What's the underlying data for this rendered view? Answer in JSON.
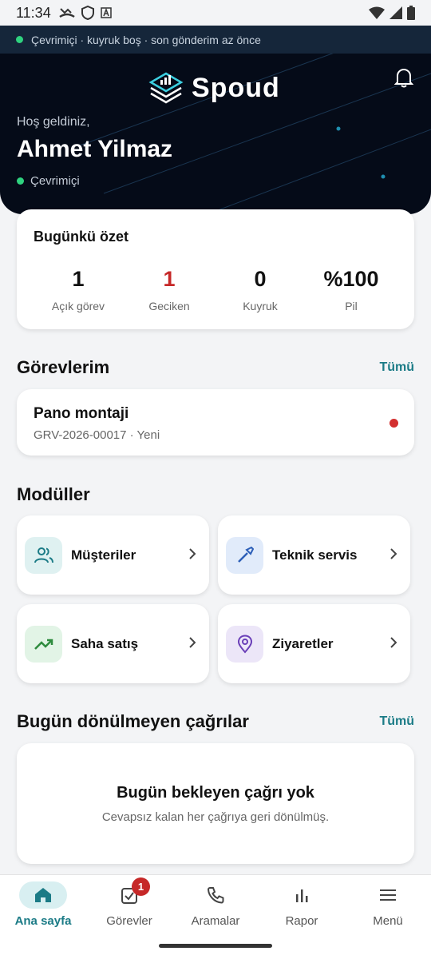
{
  "status_bar": {
    "time": "11:34"
  },
  "connection": {
    "text": "Çevrimiçi · kuyruk boş · son gönderim az önce"
  },
  "header": {
    "brand": "Spoud",
    "welcome": "Hoş geldiniz,",
    "user_name": "Ahmet Yilmaz",
    "user_status": "Çevrimiçi"
  },
  "summary": {
    "title": "Bugünkü özet",
    "stats": [
      {
        "value": "1",
        "label": "Açık görev"
      },
      {
        "value": "1",
        "label": "Geciken"
      },
      {
        "value": "0",
        "label": "Kuyruk"
      },
      {
        "value": "%100",
        "label": "Pil"
      }
    ]
  },
  "tasks": {
    "title": "Görevlerim",
    "see_all": "Tümü",
    "items": [
      {
        "title": "Pano montaji",
        "subtitle": "GRV-2026-00017 · Yeni"
      }
    ]
  },
  "modules": {
    "title": "Modüller",
    "items": [
      {
        "label": "Müşteriler",
        "icon": "users-icon"
      },
      {
        "label": "Teknik servis",
        "icon": "wrench-icon"
      },
      {
        "label": "Saha satış",
        "icon": "trend-up-icon"
      },
      {
        "label": "Ziyaretler",
        "icon": "map-pin-icon"
      }
    ]
  },
  "calls": {
    "title": "Bugün dönülmeyen çağrılar",
    "see_all": "Tümü",
    "empty_title": "Bugün bekleyen çağrı yok",
    "empty_subtitle": "Cevapsız kalan her çağrıya geri dönülmüş."
  },
  "nav": {
    "items": [
      {
        "label": "Ana sayfa",
        "icon": "home-icon",
        "active": true
      },
      {
        "label": "Görevler",
        "icon": "task-check-icon",
        "badge": "1"
      },
      {
        "label": "Aramalar",
        "icon": "phone-icon"
      },
      {
        "label": "Rapor",
        "icon": "bar-chart-icon"
      },
      {
        "label": "Menü",
        "icon": "menu-icon"
      }
    ]
  },
  "colors": {
    "accent": "#1b7b86",
    "header_bg": "#050b18",
    "online": "#2fd27f",
    "alert": "#c62828"
  }
}
